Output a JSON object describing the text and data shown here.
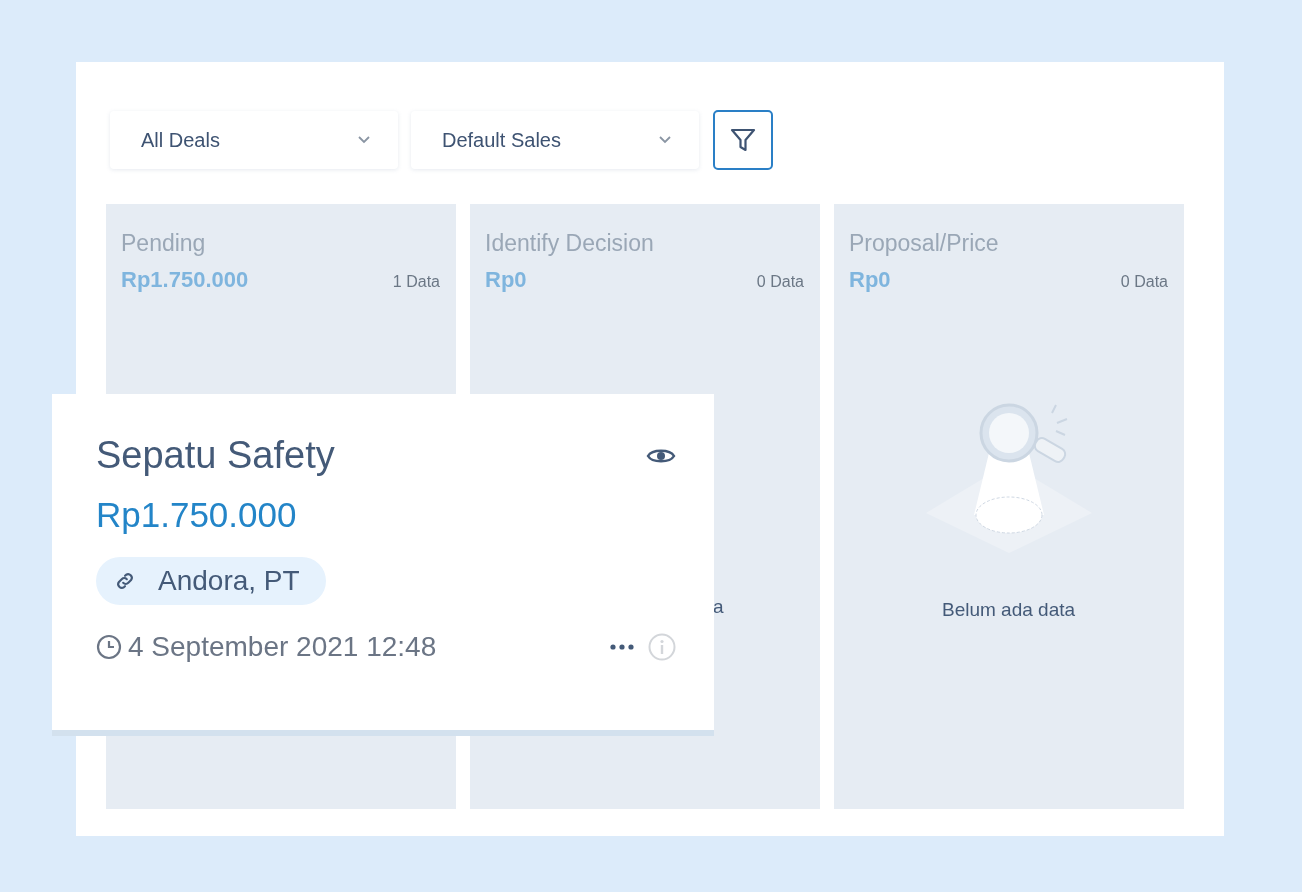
{
  "filters": [
    {
      "label": "All Deals"
    },
    {
      "label": "Default Sales"
    }
  ],
  "columns": [
    {
      "title": "Pending",
      "amount": "Rp1.750.000",
      "count": "1 Data"
    },
    {
      "title": "Identify Decision",
      "amount": "Rp0",
      "count": "0 Data",
      "empty": {
        "text": "a",
        "covered": true
      }
    },
    {
      "title": "Proposal/Price",
      "amount": "Rp0",
      "count": "0 Data",
      "empty": {
        "text": "Belum ada data",
        "covered": false
      }
    }
  ],
  "card": {
    "title": "Sepatu Safety",
    "amount": "Rp1.750.000",
    "company": "Andora, PT",
    "date": "4 September 2021 12:48"
  }
}
